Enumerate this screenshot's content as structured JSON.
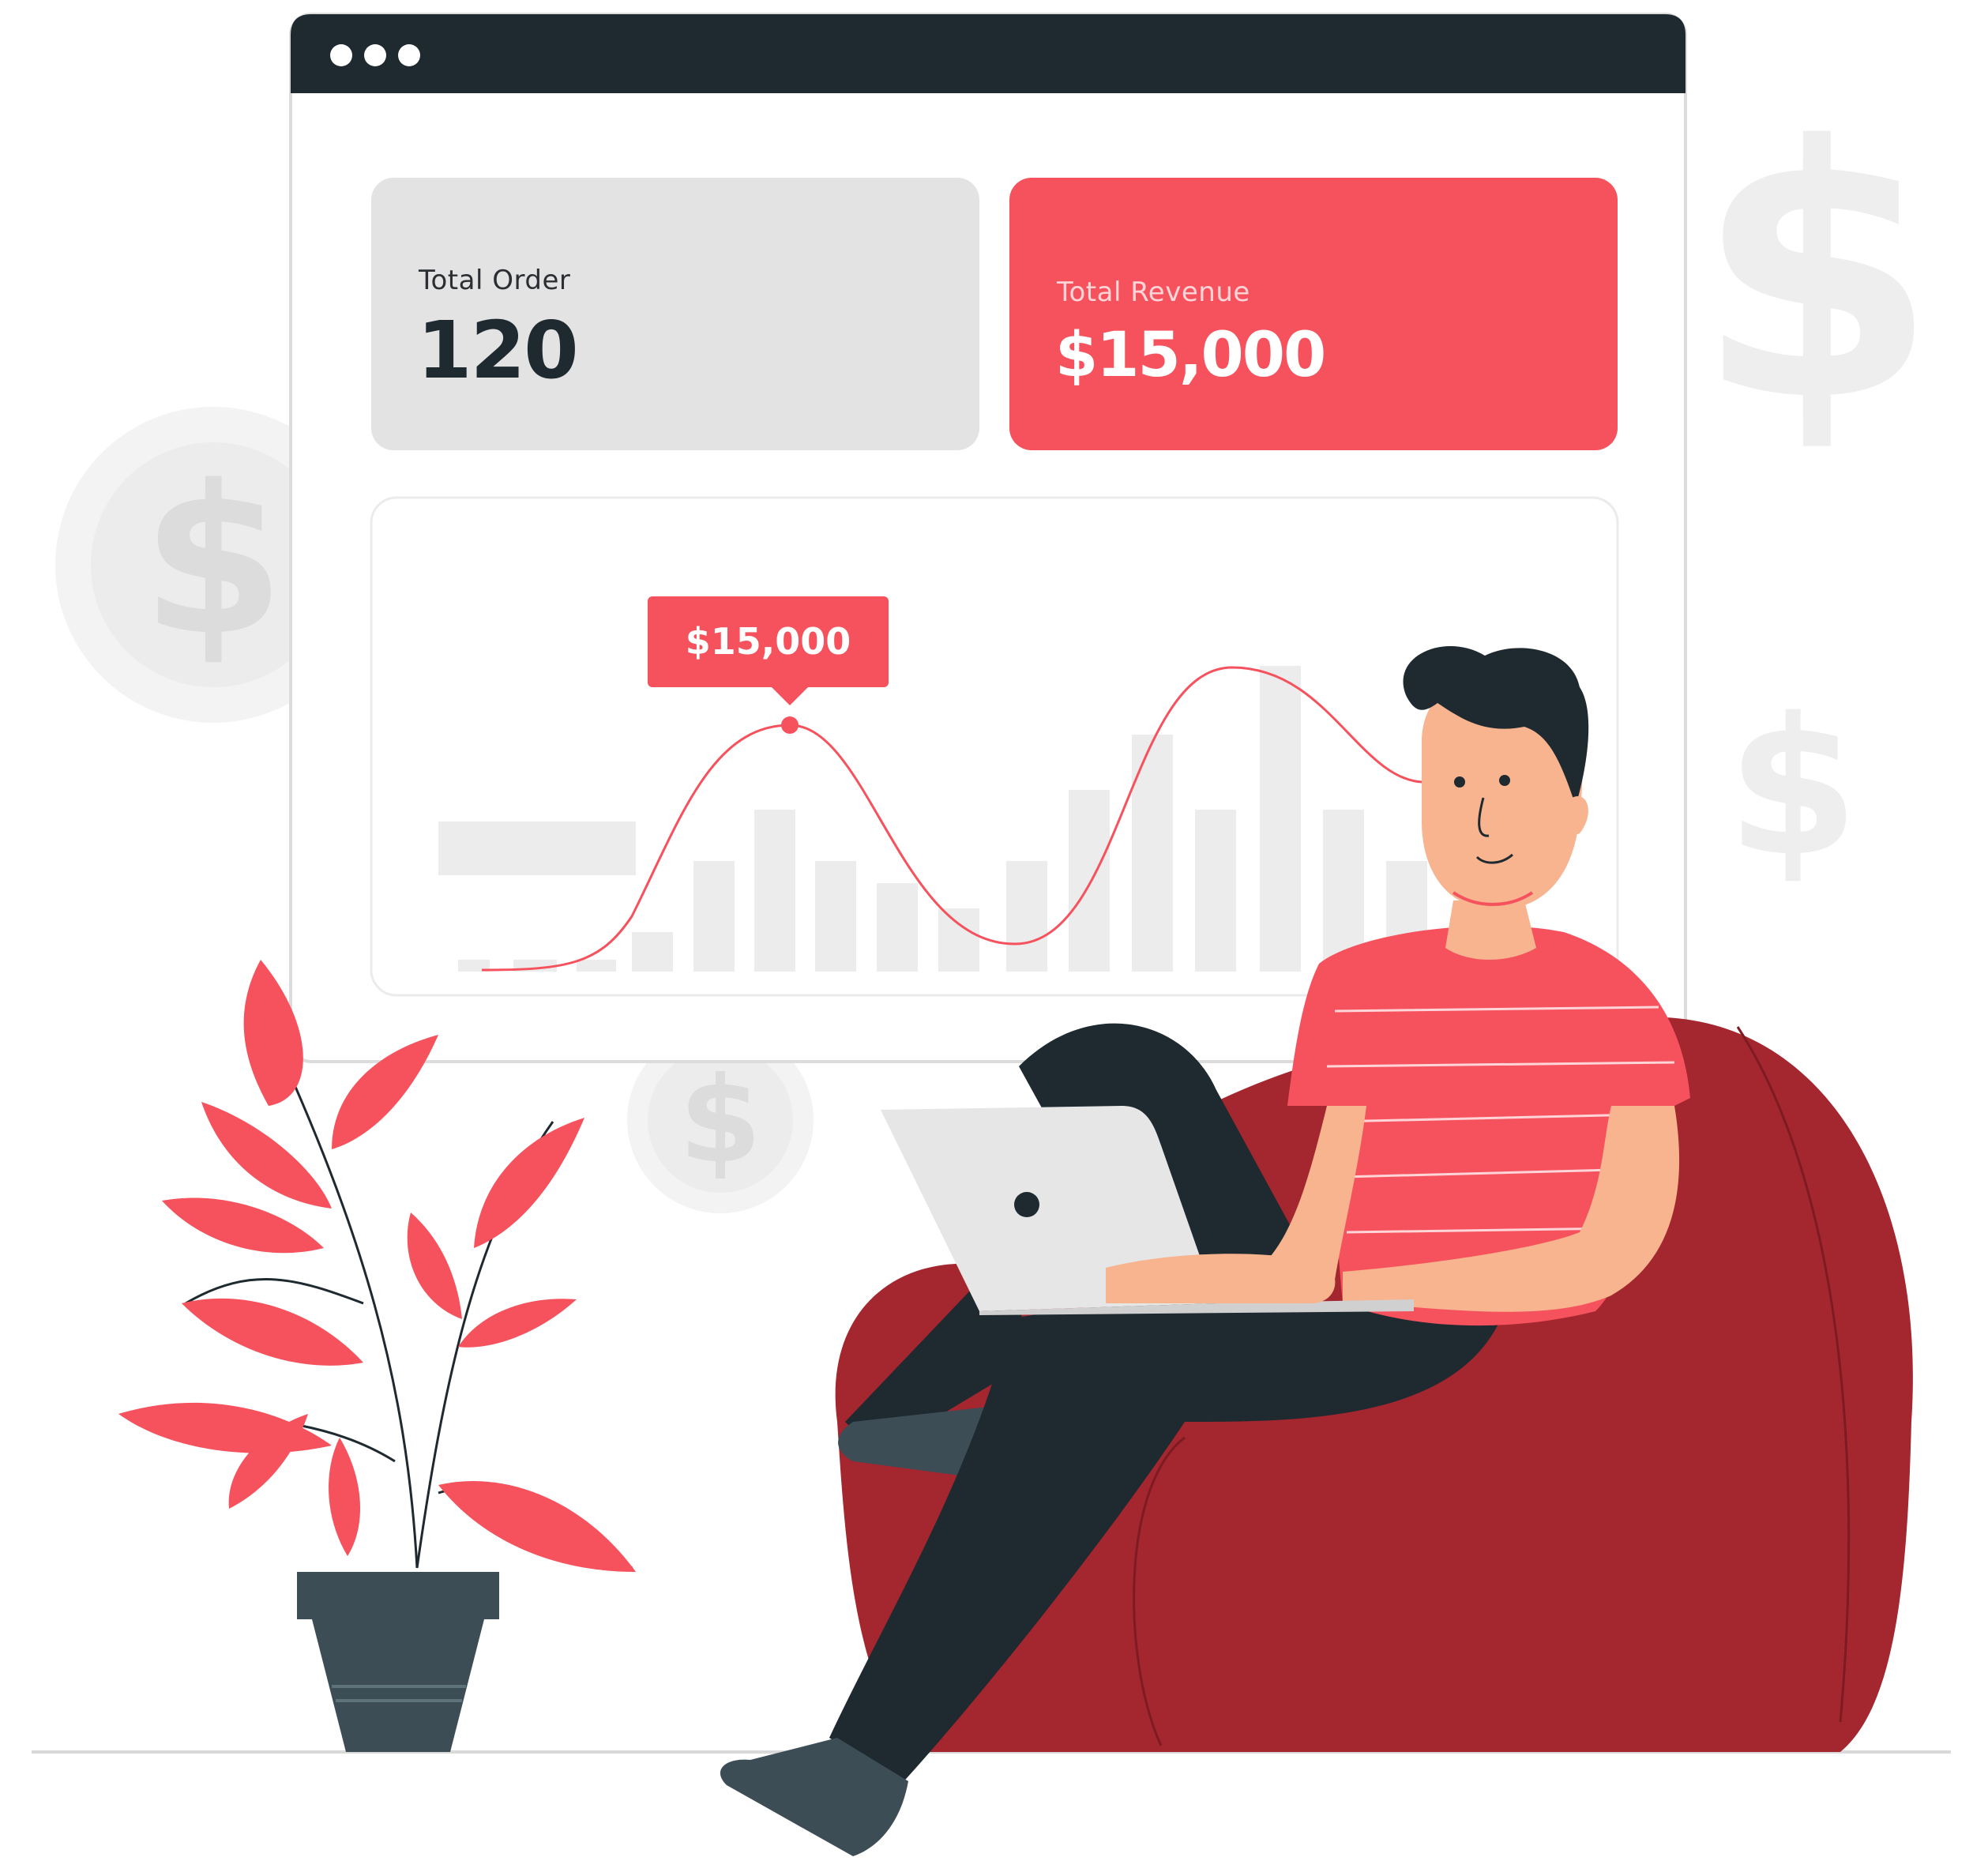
{
  "dashboard": {
    "window_dots": 3,
    "total_order": {
      "label": "Total Order",
      "value": "120"
    },
    "total_revenue": {
      "label": "Total Revenue",
      "value": "$15,000"
    },
    "chart_tooltip": "$15,000"
  },
  "colors": {
    "accent_red": "#f6525d",
    "dark_navy": "#1e2930",
    "bean_bag": "#a4262f",
    "light_gray": "#e3e3e3"
  }
}
